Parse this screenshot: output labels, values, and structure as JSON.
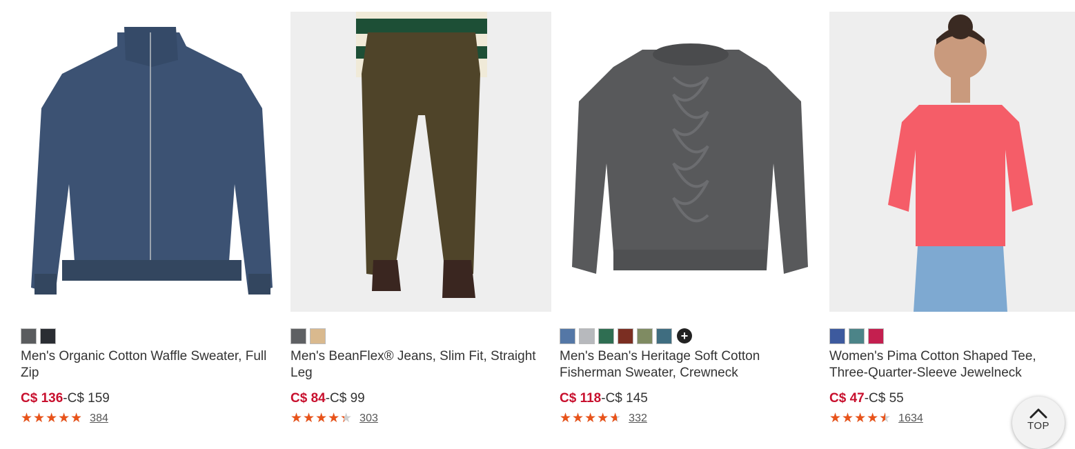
{
  "products": [
    {
      "name": "Men's Organic Cotton Waffle Sweater, Full Zip",
      "price_sale": "C$ 136",
      "price_sep": "-",
      "price_regular": "C$ 159",
      "rating": 4.8,
      "review_count": "384",
      "swatches": [
        "#5a5c5e",
        "#2a2d33"
      ],
      "more_colors": false
    },
    {
      "name": "Men's BeanFlex® Jeans, Slim Fit, Straight Leg",
      "price_sale": "C$ 84",
      "price_sep": "-",
      "price_regular": "C$ 99",
      "rating": 4.3,
      "review_count": "303",
      "swatches": [
        "#5e6063",
        "#d9b98e"
      ],
      "more_colors": false
    },
    {
      "name": "Men's Bean's Heritage Soft Cotton Fisherman Sweater, Crewneck",
      "price_sale": "C$ 118",
      "price_sep": "-",
      "price_regular": "C$ 145",
      "rating": 4.6,
      "review_count": "332",
      "swatches": [
        "#5477a6",
        "#b7b9bd",
        "#2f6e52",
        "#7b2e22",
        "#7f8b62",
        "#3f6d80"
      ],
      "more_colors": true
    },
    {
      "name": "Women's Pima Cotton Shaped Tee, Three-Quarter-Sleeve Jewelneck",
      "price_sale": "C$ 47",
      "price_sep": "-",
      "price_regular": "C$ 55",
      "rating": 4.5,
      "review_count": "1634",
      "swatches": [
        "#3d5a9e",
        "#4c8488",
        "#c41f4f"
      ],
      "more_colors": false
    }
  ],
  "more_colors_glyph": "+",
  "star_glyphs": "★★★★★",
  "top_button": {
    "label": "TOP",
    "icon": "chevron-up-icon"
  },
  "colors": {
    "sale": "#c8102e",
    "star": "#e8531a"
  }
}
